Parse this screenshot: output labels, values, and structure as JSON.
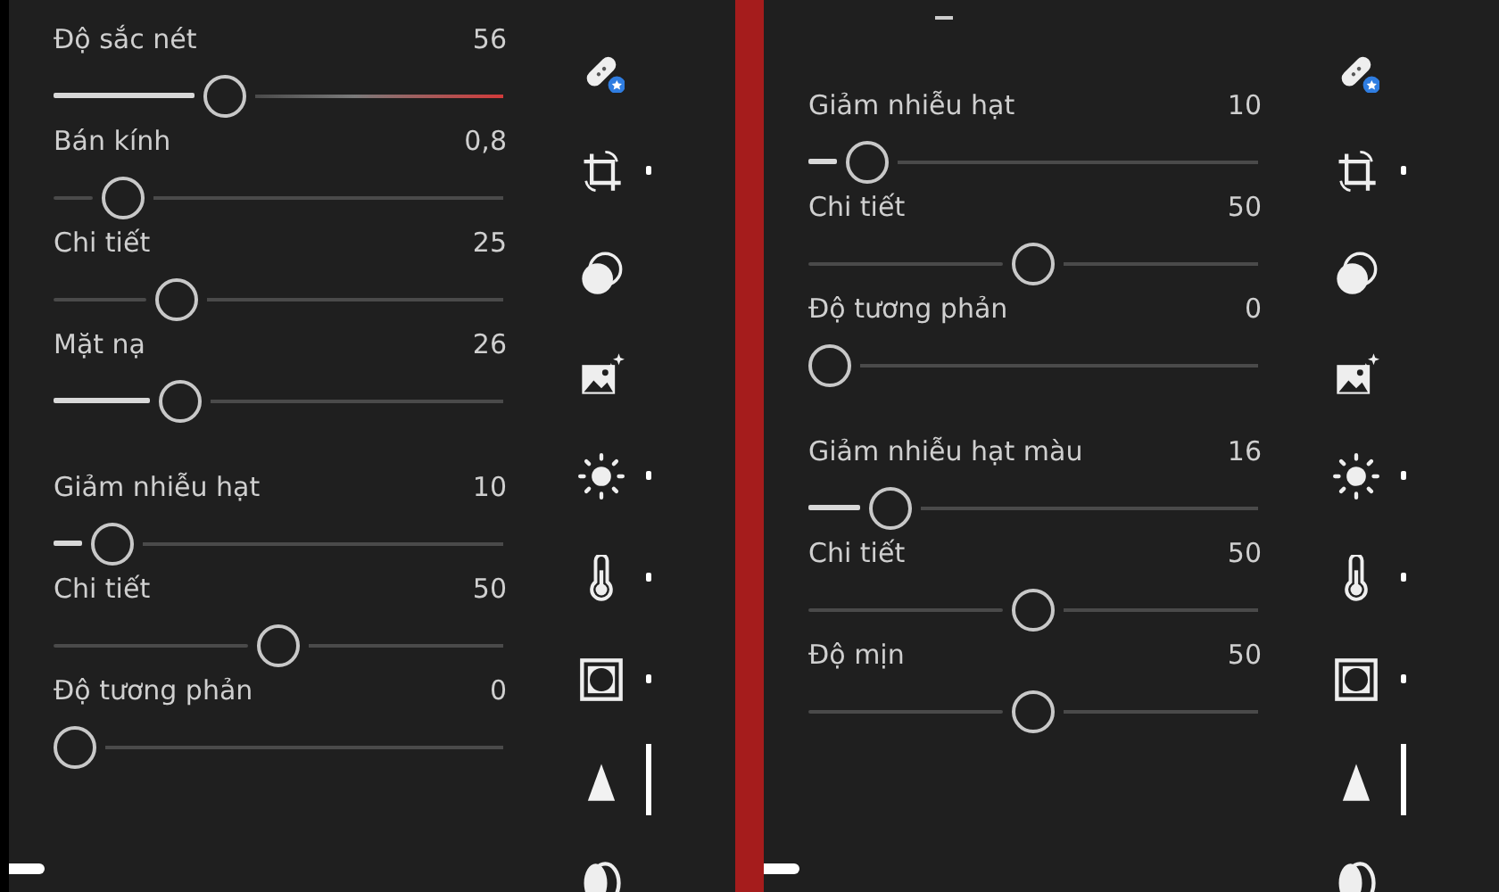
{
  "panels": [
    {
      "groups": [
        {
          "sliders": [
            {
              "label": "Độ sắc nét",
              "value": "56",
              "level": 0.37,
              "active": true,
              "warning": true
            },
            {
              "label": "Bán kính",
              "value": "0,8",
              "level": 0.12,
              "active": false,
              "warning": false
            },
            {
              "label": "Chi tiết",
              "value": "25",
              "level": 0.25,
              "active": false,
              "warning": false
            },
            {
              "label": "Mặt nạ",
              "value": "26",
              "level": 0.26,
              "active": true,
              "warning": false
            }
          ]
        },
        {
          "sliders": [
            {
              "label": "Giảm nhiễu hạt",
              "value": "10",
              "level": 0.09,
              "active": true,
              "warning": false
            },
            {
              "label": "Chi tiết",
              "value": "50",
              "level": 0.5,
              "active": false,
              "warning": false
            },
            {
              "label": "Độ tương phản",
              "value": "0",
              "level": 0,
              "warning": false
            }
          ]
        }
      ],
      "rail": [
        {
          "items": [
            {
              "kind": "healing",
              "selected": false,
              "modified": false
            },
            {
              "kind": "crop",
              "selected": false,
              "modified": true
            },
            {
              "kind": "masking",
              "selected": false,
              "modified": false
            }
          ]
        },
        {
          "items": [
            {
              "kind": "enhance",
              "selected": false,
              "modified": false
            },
            {
              "kind": "light",
              "selected": false,
              "modified": true
            },
            {
              "kind": "color",
              "selected": false,
              "modified": true
            },
            {
              "kind": "effects",
              "selected": false,
              "modified": true
            },
            {
              "kind": "detail",
              "selected": true,
              "modified": false
            },
            {
              "kind": "optics",
              "selected": false,
              "modified": false
            }
          ]
        }
      ]
    },
    {
      "scrolled": true,
      "groups": [
        {
          "sliders": [
            {
              "label": "Giảm nhiễu hạt",
              "value": "10",
              "level": 0.09,
              "active": true,
              "warning": false
            },
            {
              "label": "Chi tiết",
              "value": "50",
              "level": 0.5,
              "active": false,
              "warning": false
            },
            {
              "label": "Độ tương phản",
              "value": "0",
              "level": 0,
              "warning": false
            }
          ]
        },
        {
          "sliders": [
            {
              "label": "Giảm nhiễu hạt màu",
              "value": "16",
              "level": 0.15,
              "active": true,
              "warning": false
            },
            {
              "label": "Chi tiết",
              "value": "50",
              "level": 0.5,
              "active": false,
              "warning": false
            },
            {
              "label": "Độ mịn",
              "value": "50",
              "level": 0.5,
              "active": false,
              "warning": false
            }
          ]
        }
      ],
      "rail": [
        {
          "items": [
            {
              "kind": "healing",
              "selected": false,
              "modified": false
            },
            {
              "kind": "crop",
              "selected": false,
              "modified": true
            },
            {
              "kind": "masking",
              "selected": false,
              "modified": false
            }
          ]
        },
        {
          "items": [
            {
              "kind": "enhance",
              "selected": false,
              "modified": false
            },
            {
              "kind": "light",
              "selected": false,
              "modified": true
            },
            {
              "kind": "color",
              "selected": false,
              "modified": true
            },
            {
              "kind": "effects",
              "selected": false,
              "modified": true
            },
            {
              "kind": "detail",
              "selected": true,
              "modified": false
            },
            {
              "kind": "optics",
              "selected": false,
              "modified": false
            }
          ]
        }
      ]
    }
  ]
}
